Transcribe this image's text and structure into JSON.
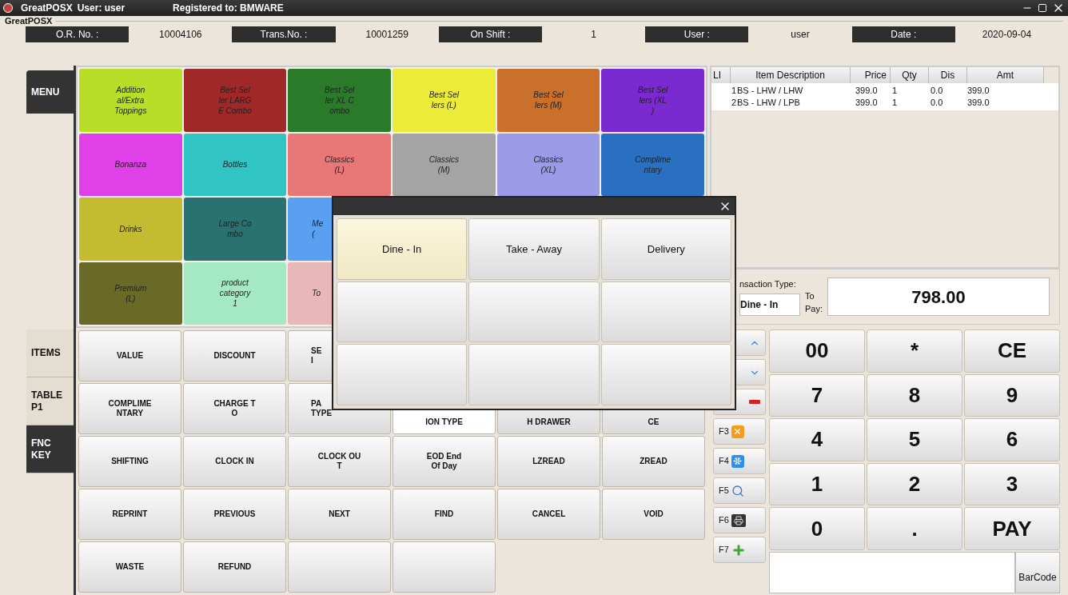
{
  "window": {
    "title": "GreatPOSX",
    "user": "User: user",
    "registration": "Registered to: BMWARE"
  },
  "group_label": "GreatPOSX",
  "info_bar": [
    {
      "label": "O.R. No. :",
      "value": "10004106"
    },
    {
      "label": "Trans.No. :",
      "value": "10001259"
    },
    {
      "label": "On Shift :",
      "value": "1"
    },
    {
      "label": "User :",
      "value": "user"
    },
    {
      "label": "Date :",
      "value": "2020-09-04"
    }
  ],
  "left_tabs_top": [
    {
      "label": "MENU",
      "selected": true
    }
  ],
  "left_tabs_bottom": [
    {
      "label": "ITEMS",
      "selected": false
    },
    {
      "label": "TABLE\nP1",
      "selected": false
    },
    {
      "label": "FNC\nKEY",
      "selected": true
    }
  ],
  "categories": [
    [
      {
        "kind": "text",
        "label": "Addition\nal/Extra\nToppings",
        "color": "#b8de28"
      },
      {
        "kind": "text",
        "label": "Best Sel\nler LARG\nE Combo",
        "color": "#a02828"
      },
      {
        "kind": "text",
        "label": "Best Sel\nler XL C\nombo",
        "color": "#2a7a2a"
      },
      {
        "kind": "text",
        "label": "Best Sel\nlers (L)",
        "color": "#ecec38"
      },
      {
        "kind": "text",
        "label": "Best Sel\nlers (M)",
        "color": "#c8702c"
      },
      {
        "kind": "text",
        "label": "Best Sel\nlers (XL\n)",
        "color": "#7a2ad0"
      }
    ],
    [
      {
        "kind": "text",
        "label": "Bonanza",
        "color": "#e040e8"
      },
      {
        "kind": "text",
        "label": "Bottles",
        "color": "#30c4c4"
      },
      {
        "kind": "text",
        "label": "Classics\n(L)",
        "color": "#e87878"
      },
      {
        "kind": "text",
        "label": "Classics\n(M)",
        "color": "#a4a4a4"
      },
      {
        "kind": "text",
        "label": "Classics\n(XL)",
        "color": "#9a9ae6"
      },
      {
        "kind": "text",
        "label": "Complime\nntary",
        "color": "#2a70c0"
      }
    ],
    [
      {
        "kind": "text",
        "label": "Drinks",
        "color": "#c4bc30"
      },
      {
        "kind": "text",
        "label": "Large Co\nmbo",
        "color": "#2a7272"
      },
      {
        "kind": "cut_left",
        "label": "Me\n(",
        "color": "#5aa0f0"
      }
    ],
    [
      {
        "kind": "text",
        "label": "Premium\n(L)",
        "color": "#6a6a28"
      },
      {
        "kind": "text",
        "label": "product\ncategory\n1",
        "color": "#a4e8c4"
      },
      {
        "kind": "cut_left",
        "label": "To",
        "color": "#e8b8b8"
      }
    ]
  ],
  "function_keys": [
    [
      {
        "kind": "text",
        "label": "VALUE",
        "selected": false
      },
      {
        "kind": "text",
        "label": "DISCOUNT",
        "selected": false
      },
      {
        "kind": "cut_left",
        "label": "SE\nI",
        "selected": false
      }
    ],
    [
      {
        "kind": "text",
        "label": "COMPLIME\nNTARY",
        "selected": false
      },
      {
        "kind": "text",
        "label": "CHARGE T\nO",
        "selected": false
      },
      {
        "kind": "cut_left",
        "label": "PA\nTYPE",
        "selected": false
      },
      {
        "kind": "cut_bottom",
        "label": "ION TYPE",
        "selected": true
      },
      {
        "kind": "cut_bottom",
        "label": "H DRAWER",
        "selected": false
      },
      {
        "kind": "cut_bottom",
        "label": "CE",
        "selected": false
      }
    ],
    [
      {
        "kind": "text",
        "label": "SHIFTING",
        "selected": false
      },
      {
        "kind": "text",
        "label": "CLOCK IN",
        "selected": false
      },
      {
        "kind": "text",
        "label": "CLOCK OU\nT",
        "selected": false
      },
      {
        "kind": "text",
        "label": "EOD End\nOf Day",
        "selected": false
      },
      {
        "kind": "text",
        "label": "LZREAD",
        "selected": false
      },
      {
        "kind": "text",
        "label": "ZREAD",
        "selected": false
      }
    ],
    [
      {
        "kind": "text",
        "label": "REPRINT",
        "selected": false
      },
      {
        "kind": "text",
        "label": "PREVIOUS",
        "selected": false
      },
      {
        "kind": "text",
        "label": "NEXT",
        "selected": false
      },
      {
        "kind": "text",
        "label": "FIND",
        "selected": false
      },
      {
        "kind": "text",
        "label": "CANCEL",
        "selected": false
      },
      {
        "kind": "text",
        "label": "VOID",
        "selected": false
      }
    ],
    [
      {
        "kind": "text",
        "label": "WASTE",
        "selected": false
      },
      {
        "kind": "text",
        "label": "REFUND",
        "selected": false
      },
      {
        "kind": "blank",
        "selected": false
      },
      {
        "kind": "blank",
        "selected": false
      }
    ]
  ],
  "order_table": {
    "columns": [
      "LI",
      "Item Description",
      "Price",
      "Qty",
      "Dis",
      "Amt"
    ],
    "rows": [
      [
        "1",
        "BS - LHW / LHW",
        "399.0",
        "1",
        "0.0",
        "399.0"
      ],
      [
        "2",
        "BS - LHW / LPB",
        "399.0",
        "1",
        "0.0",
        "399.0"
      ]
    ]
  },
  "transaction": {
    "type_label": "nsaction Type:",
    "type_value": "Dine - In",
    "to_pay_label": "To\nPay:",
    "total": "798.00"
  },
  "side_keys": [
    {
      "kind": "up"
    },
    {
      "kind": "down"
    },
    {
      "kind": "minus"
    },
    {
      "kind": "cancel",
      "label": "F3"
    },
    {
      "kind": "snow",
      "label": "F4"
    },
    {
      "kind": "search",
      "label": "F5"
    },
    {
      "kind": "printer",
      "label": "F6"
    },
    {
      "kind": "plus",
      "label": "F7"
    }
  ],
  "keypad": [
    "00",
    "*",
    "CE",
    "7",
    "8",
    "9",
    "4",
    "5",
    "6",
    "1",
    "2",
    "3",
    "0",
    ".",
    "PAY"
  ],
  "barcode": {
    "button": "BarCode"
  },
  "dialog": {
    "options": [
      {
        "kind": "option",
        "label": "Dine - In",
        "selected": true
      },
      {
        "kind": "option",
        "label": "Take - Away",
        "selected": false
      },
      {
        "kind": "option",
        "label": "Delivery",
        "selected": false
      },
      {
        "kind": "blank",
        "selected": false
      },
      {
        "kind": "blank",
        "selected": false
      },
      {
        "kind": "blank",
        "selected": false
      },
      {
        "kind": "blank",
        "selected": false
      },
      {
        "kind": "blank",
        "selected": false
      },
      {
        "kind": "blank",
        "selected": false
      }
    ]
  }
}
